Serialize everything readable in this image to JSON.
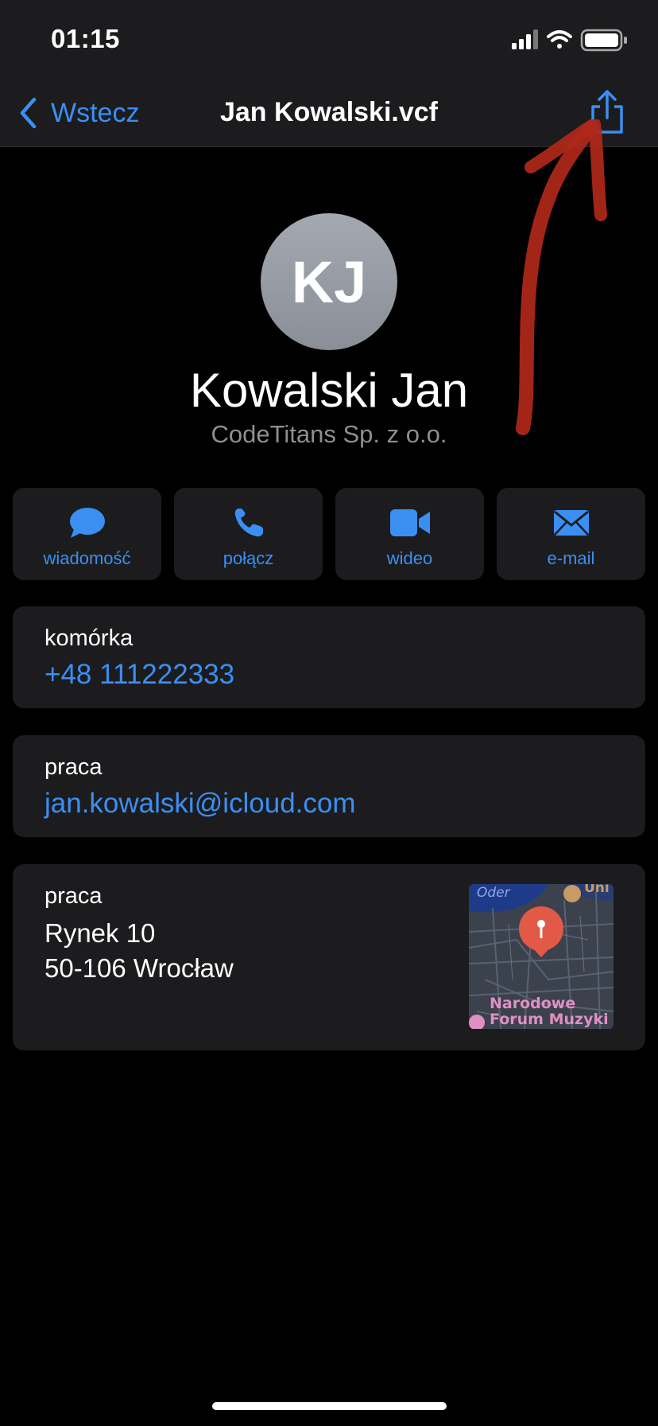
{
  "status_bar": {
    "time": "01:15"
  },
  "nav": {
    "back_label": "Wstecz",
    "title": "Jan Kowalski.vcf"
  },
  "contact": {
    "initials": "KJ",
    "name": "Kowalski Jan",
    "company": "CodeTitans Sp. z o.o."
  },
  "actions": [
    {
      "label": "wiadomość",
      "icon": "message-bubble-icon"
    },
    {
      "label": "połącz",
      "icon": "phone-icon"
    },
    {
      "label": "wideo",
      "icon": "video-camera-icon"
    },
    {
      "label": "e-mail",
      "icon": "envelope-icon"
    }
  ],
  "phone": {
    "label": "komórka",
    "value": "+48 111222333"
  },
  "email": {
    "label": "praca",
    "value": "jan.kowalski@icloud.com"
  },
  "address": {
    "label": "praca",
    "line1": "Rynek 10",
    "line2": "50-106 Wrocław",
    "map": {
      "river_label": "Oder",
      "top_right_label": "Uni Wro",
      "poi_label_1": "Narodowe",
      "poi_label_2": "Forum Muzyki"
    }
  },
  "colors": {
    "accent": "#3b8ff3",
    "card": "#1c1c1e",
    "annotation": "#b0281a"
  }
}
